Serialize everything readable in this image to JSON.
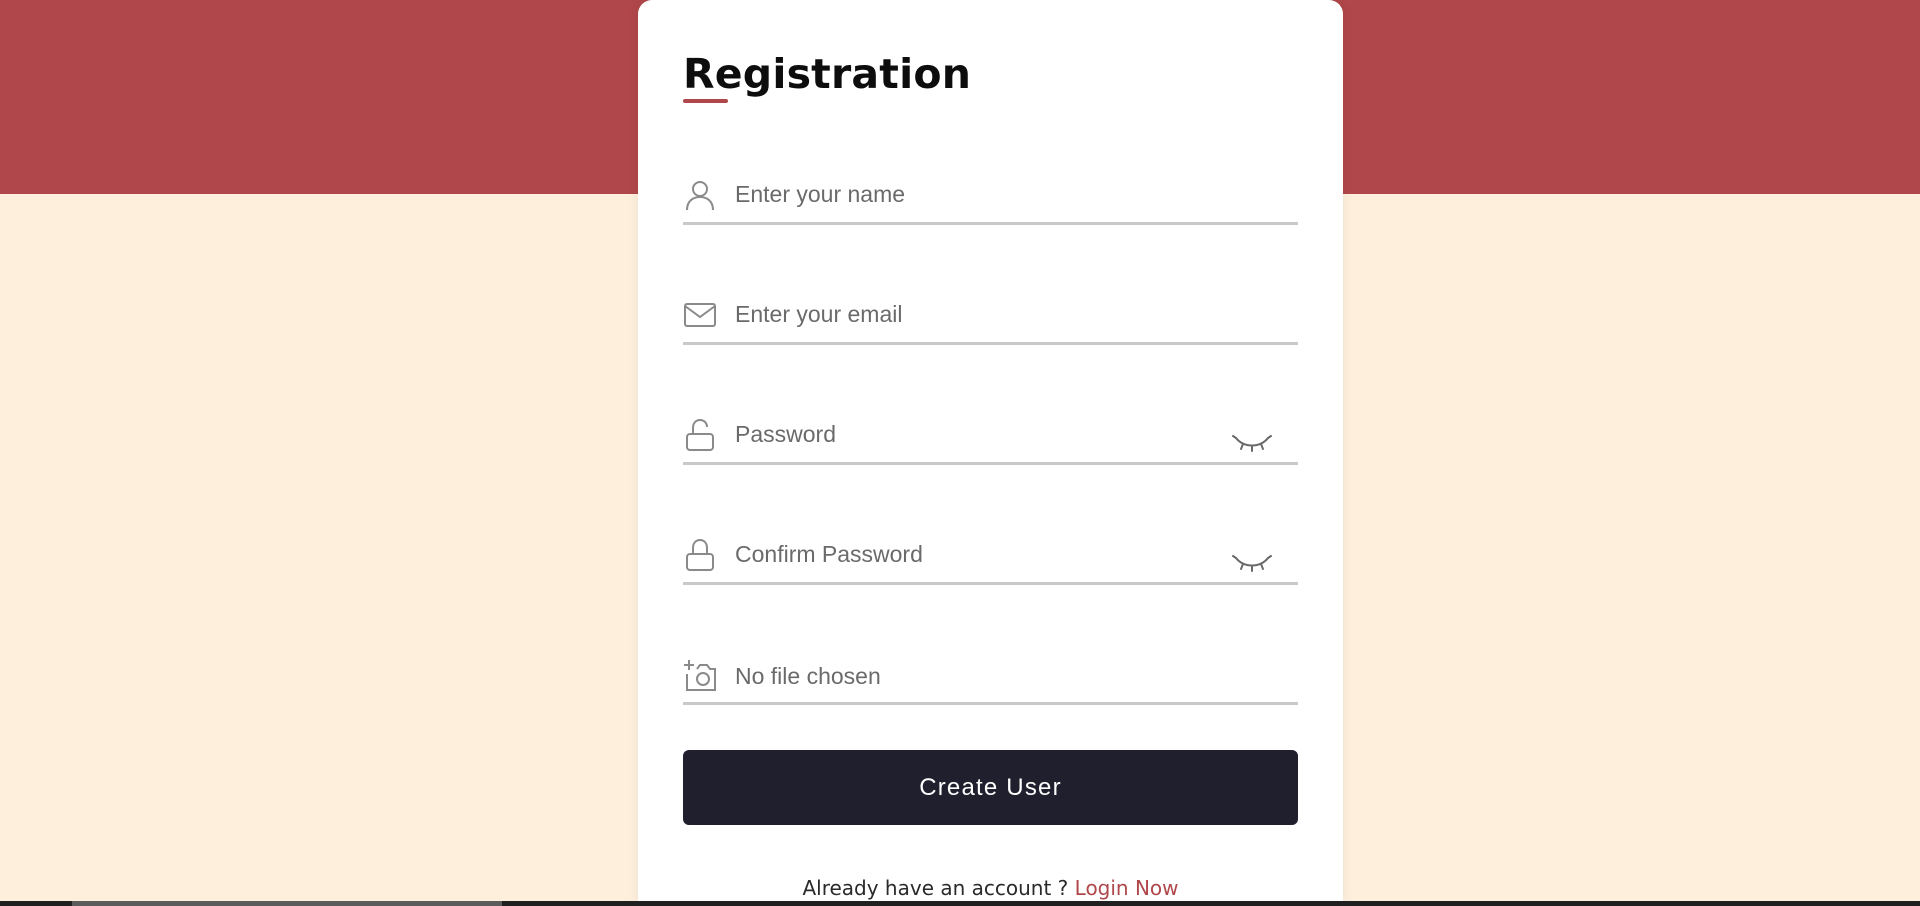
{
  "form": {
    "title": "Registration",
    "name_placeholder": "Enter your name",
    "email_placeholder": "Enter your email",
    "password_placeholder": "Password",
    "confirm_password_placeholder": "Confirm Password",
    "file_label": "No file chosen",
    "submit_label": "Create User",
    "footer_prompt": "Already have an account ? ",
    "footer_link": "Login Now"
  },
  "icons": {
    "name": "user-icon",
    "email": "envelope-icon",
    "password": "unlock-icon",
    "confirm_password": "lock-icon",
    "file": "add-photo-icon",
    "toggle": "eye-closed-icon"
  },
  "colors": {
    "accent": "#b0474a",
    "background": "#fdefdc",
    "button": "#1f1f2e",
    "card": "#ffffff"
  }
}
